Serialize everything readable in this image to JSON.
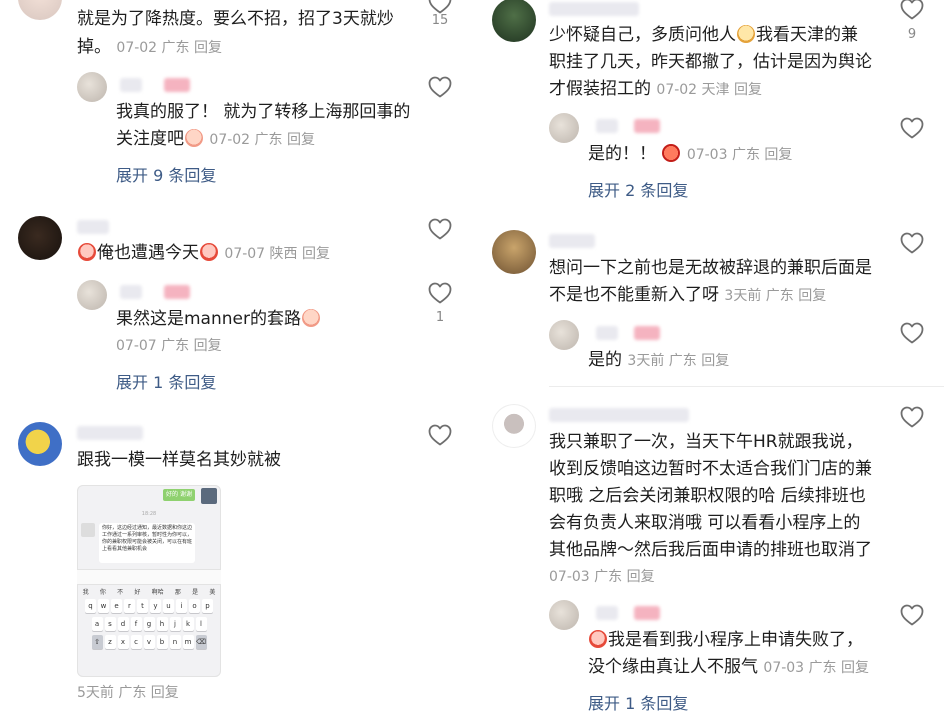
{
  "left": {
    "c1": {
      "line1": "就是为了降热度。要么不招，招了3天就炒",
      "line2": "掉。",
      "meta": "07-02 广东 回复",
      "likes": "15",
      "reply": {
        "line1": "我真的服了！ 就为了转移上海那回事的",
        "line2": "关注度吧",
        "meta": "07-02 广东 回复"
      },
      "expand": "展开 9 条回复"
    },
    "c2": {
      "text": "俺也遭遇今天",
      "meta": "07-07 陕西 回复",
      "reply": {
        "text": "果然这是manner的套路",
        "meta": "07-07 广东 回复",
        "likes": "1"
      },
      "expand": "展开 1 条回复"
    },
    "c3": {
      "text": "跟我一模一样莫名其妙就被",
      "meta": "5天前 广东 回复",
      "screenshot": {
        "green_label": "好的 谢谢",
        "time": "18:28",
        "bubble": "你好，这边经过通知，最近数据和你这边工作通过一系列审核，暂时性为你可以，你的兼职权限可能会被关闭，可以在有班上看看其他兼职机会",
        "candidates": [
          "我",
          "你",
          "不",
          "好",
          "啊哈",
          "那",
          "是",
          "美"
        ]
      }
    }
  },
  "right": {
    "c1": {
      "line1": "少怀疑自己，多质问他人",
      "line1b": "我看天津的兼",
      "line2": "职挂了几天，昨天都撤了，估计是因为舆论",
      "line3": "才假装招工的",
      "meta": "07-02 天津 回复",
      "likes": "9",
      "reply": {
        "text": "是的！！",
        "meta": "07-03 广东 回复"
      },
      "expand": "展开 2 条回复"
    },
    "c2": {
      "line1": "想问一下之前也是无故被辞退的兼职后面是",
      "line2": "不是也不能重新入了呀",
      "meta": "3天前 广东 回复",
      "reply": {
        "text": "是的",
        "meta": "3天前 广东 回复"
      }
    },
    "c3": {
      "line1": "我只兼职了一次，当天下午HR就跟我说，",
      "line2": "收到反馈咱这边暂时不太适合我们门店的兼",
      "line3": "职哦 之后会关闭兼职权限的哈 后续排班也",
      "line4": "会有负责人来取消哦 可以看看小程序上的",
      "line5": "其他品牌～然后我后面申请的排班也取消了",
      "meta": "07-03 广东 回复",
      "reply": {
        "line1": "我是看到我小程序上申请失败了，",
        "line2": "没个缘由真让人不服气",
        "meta": "07-03 广东 回复"
      },
      "expand": "展开 1 条回复"
    }
  },
  "colors": {
    "accent_link": "#3e5b86",
    "meta": "#9a9a9a",
    "author_tag": "#f5b3c0"
  }
}
